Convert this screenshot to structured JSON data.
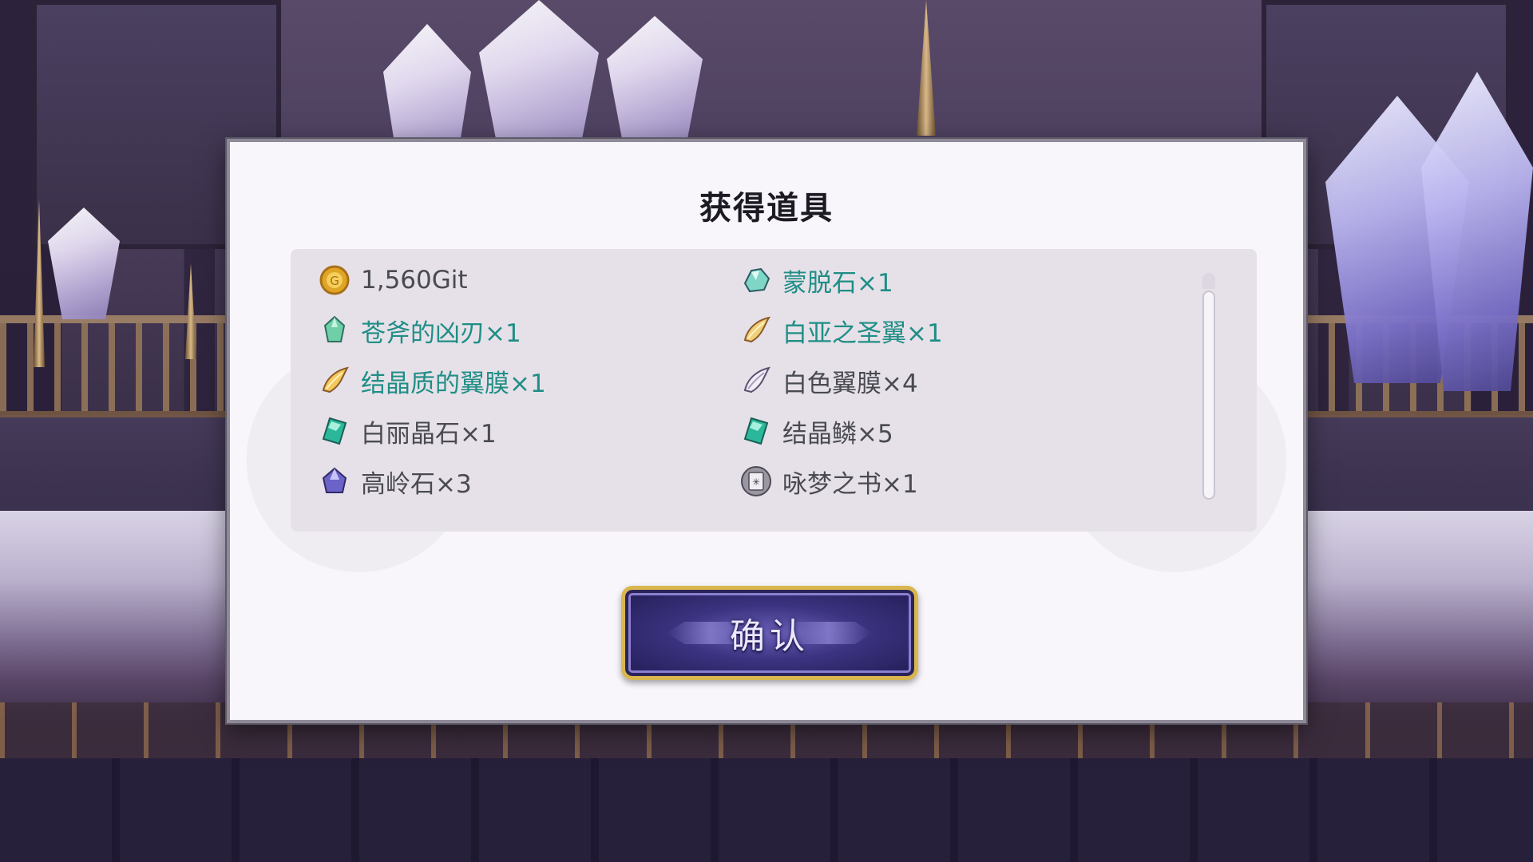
{
  "dialog": {
    "title": "获得道具",
    "confirm_label": "确认"
  },
  "items": [
    {
      "label": "1,560Git",
      "icon": "gold-coin-icon",
      "highlight": false
    },
    {
      "label": "蒙脱石×1",
      "icon": "crystal-ore-icon",
      "highlight": true
    },
    {
      "label": "苍斧的凶刃×1",
      "icon": "green-crystal-icon",
      "highlight": true
    },
    {
      "label": "白亚之圣翼×1",
      "icon": "golden-wing-icon",
      "highlight": true
    },
    {
      "label": "结晶质的翼膜×1",
      "icon": "golden-wing-icon",
      "highlight": true
    },
    {
      "label": "白色翼膜×4",
      "icon": "white-wing-icon",
      "highlight": false
    },
    {
      "label": "白丽晶石×1",
      "icon": "emerald-gem-icon",
      "highlight": false
    },
    {
      "label": "结晶鳞×5",
      "icon": "emerald-gem-icon",
      "highlight": false
    },
    {
      "label": "高岭石×3",
      "icon": "purple-ore-icon",
      "highlight": false
    },
    {
      "label": "咏梦之书×1",
      "icon": "book-icon",
      "highlight": false
    }
  ],
  "colors": {
    "highlight_text": "#1f8e86",
    "normal_text": "#4a4a52",
    "button_border": "#d9b64e"
  }
}
